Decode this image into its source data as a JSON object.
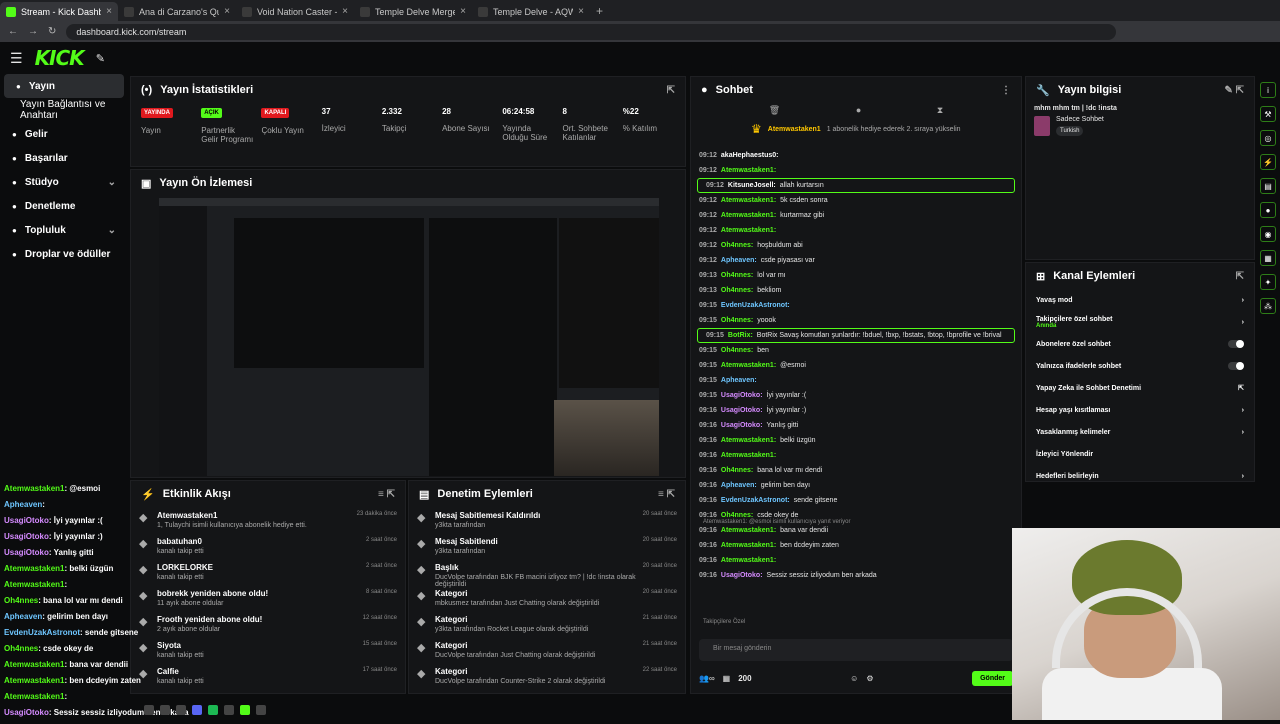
{
  "tabs": [
    {
      "title": "Stream - Kick Dashboard"
    },
    {
      "title": "Ana di Carzano's Quests - AQW"
    },
    {
      "title": "Void Nation Caster - AQW"
    },
    {
      "title": "Temple Delve Merge - AQW"
    },
    {
      "title": "Temple Delve - AQW"
    }
  ],
  "url": "dashboard.kick.com/stream",
  "logo": "KICK",
  "sidebar": [
    {
      "label": "Yayın",
      "icon": "stream-icon",
      "active": true
    },
    {
      "label": "Yayın Bağlantısı ve Anahtarı",
      "sub": true
    },
    {
      "label": "Gelir",
      "icon": "money-icon"
    },
    {
      "label": "Başarılar",
      "icon": "trophy-icon"
    },
    {
      "label": "Stüdyo",
      "icon": "studio-icon",
      "chev": true
    },
    {
      "label": "Denetleme",
      "icon": "hammer-icon"
    },
    {
      "label": "Topluluk",
      "icon": "community-icon",
      "chev": true
    },
    {
      "label": "Droplar ve ödüller",
      "icon": "gift-icon"
    }
  ],
  "stats": {
    "title": "Yayın İstatistikleri",
    "items": [
      {
        "badge": "YAYINDA",
        "label": "Yayın",
        "color": "red"
      },
      {
        "badge": "AÇIK",
        "label": "Partnerlik Gelir Programı",
        "color": "green"
      },
      {
        "badge": "KAPALI",
        "label": "Çoklu Yayın",
        "color": "red"
      },
      {
        "value": "37",
        "label": "İzleyici"
      },
      {
        "value": "2.332",
        "label": "Takipçi"
      },
      {
        "value": "28",
        "label": "Abone Sayısı"
      },
      {
        "value": "06:24:58",
        "label": "Yayında Olduğu Süre"
      },
      {
        "value": "8",
        "label": "Ort. Sohbete Katılanlar"
      },
      {
        "value": "%22",
        "label": "% Katılım"
      }
    ]
  },
  "preview": {
    "title": "Yayın Ön İzlemesi"
  },
  "activity": {
    "title": "Etkinlik Akışı",
    "items": [
      {
        "name": "Atemwastaken1",
        "desc": "1, Tulaychi isimli kullanıcıya abonelik hediye etti.",
        "time": "23 dakika önce"
      },
      {
        "name": "babatuhan0",
        "desc": "kanalı takip etti",
        "time": "2 saat önce"
      },
      {
        "name": "LORKELORKE",
        "desc": "kanalı takip etti",
        "time": "2 saat önce"
      },
      {
        "name": "bobrekk yeniden abone oldu!",
        "desc": "11 ayık abone oldular",
        "time": "8 saat önce"
      },
      {
        "name": "Frooth yeniden abone oldu!",
        "desc": "2 ayık abone oldular",
        "time": "12 saat önce"
      },
      {
        "name": "Siyota",
        "desc": "kanalı takip etti",
        "time": "15 saat önce"
      },
      {
        "name": "Calfie",
        "desc": "kanalı takip etti",
        "time": "17 saat önce"
      }
    ]
  },
  "moderation": {
    "title": "Denetim Eylemleri",
    "items": [
      {
        "name": "Mesaj Sabitlemesi Kaldırıldı",
        "desc": "y3kta tarafından",
        "time": "20 saat önce"
      },
      {
        "name": "Mesaj Sabitlendi",
        "desc": "y3kta tarafından",
        "time": "20 saat önce"
      },
      {
        "name": "Başlık",
        "desc": "DucVolpe tarafından BJK FB macini izliyoz tm? | !dc !insta olarak değiştirildi",
        "time": "20 saat önce"
      },
      {
        "name": "Kategori",
        "desc": "mbkusmez tarafından Just Chatting olarak değiştirildi",
        "time": "20 saat önce"
      },
      {
        "name": "Kategori",
        "desc": "y3kta tarafından Rocket League olarak değiştirildi",
        "time": "21 saat önce"
      },
      {
        "name": "Kategori",
        "desc": "DucVolpe tarafından Just Chatting olarak değiştirildi",
        "time": "21 saat önce"
      },
      {
        "name": "Kategori",
        "desc": "DucVolpe tarafından Counter-Strike 2 olarak değiştirildi",
        "time": "22 saat önce"
      }
    ]
  },
  "chat": {
    "title": "Sohbet",
    "pinned_user": "Atemwastaken1",
    "pinned_text": "1 abonelik hediye ederek 2. sıraya yükselin",
    "messages": [
      {
        "t": "09:12",
        "u": "akaHephaestus0:",
        "m": "",
        "c": "#fff"
      },
      {
        "t": "09:12",
        "u": "Atemwastaken1:",
        "m": "",
        "c": "#53fc18"
      },
      {
        "t": "09:12",
        "u": "KitsuneJosell:",
        "m": "allah kurtarsın",
        "c": "#fff",
        "hl": true
      },
      {
        "t": "09:12",
        "u": "Atemwastaken1:",
        "m": "5k csden sonra",
        "c": "#53fc18"
      },
      {
        "t": "09:12",
        "u": "Atemwastaken1:",
        "m": "kurtarmaz gibi",
        "c": "#53fc18"
      },
      {
        "t": "09:12",
        "u": "Atemwastaken1:",
        "m": "",
        "c": "#53fc18"
      },
      {
        "t": "09:12",
        "u": "Oh4nnes:",
        "m": "hoşbuldum abi",
        "c": "#53fc18"
      },
      {
        "t": "09:12",
        "u": "Apheaven:",
        "m": "csde piyasası var",
        "c": "#6ec6ff"
      },
      {
        "t": "09:13",
        "u": "Oh4nnes:",
        "m": "lol var mı",
        "c": "#53fc18"
      },
      {
        "t": "09:13",
        "u": "Oh4nnes:",
        "m": "bekliom",
        "c": "#53fc18"
      },
      {
        "t": "09:15",
        "u": "EvdenUzakAstronot:",
        "m": "",
        "c": "#6ec6ff"
      },
      {
        "t": "09:15",
        "u": "Oh4nnes:",
        "m": "yoook",
        "c": "#53fc18"
      },
      {
        "t": "09:15",
        "u": "BotRix:",
        "m": "BotRix Savaş komutları şunlardır: !bduel, !bxp, !bstats, !btop, !bprofile ve !brival",
        "c": "#53fc18",
        "hl": true
      },
      {
        "t": "09:15",
        "u": "Oh4nnes:",
        "m": "ben",
        "c": "#53fc18"
      },
      {
        "t": "09:15",
        "u": "Atemwastaken1:",
        "m": "@esmoi",
        "c": "#53fc18"
      },
      {
        "t": "09:15",
        "u": "Apheaven:",
        "m": "",
        "c": "#6ec6ff"
      },
      {
        "t": "09:15",
        "u": "UsagiOtoko:",
        "m": "İyi yayınlar :(",
        "c": "#d58bff"
      },
      {
        "t": "09:16",
        "u": "UsagiOtoko:",
        "m": "İyi yayınlar :)",
        "c": "#d58bff"
      },
      {
        "t": "09:16",
        "u": "UsagiOtoko:",
        "m": "Yanlış gitti",
        "c": "#d58bff"
      },
      {
        "t": "09:16",
        "u": "Atemwastaken1:",
        "m": "belki üzgün",
        "c": "#53fc18"
      },
      {
        "t": "09:16",
        "u": "Atemwastaken1:",
        "m": "",
        "c": "#53fc18"
      },
      {
        "t": "09:16",
        "u": "Oh4nnes:",
        "m": "bana lol var mı dendi",
        "c": "#53fc18"
      },
      {
        "t": "09:16",
        "u": "Apheaven:",
        "m": "gelirim ben dayı",
        "c": "#6ec6ff"
      },
      {
        "t": "09:16",
        "u": "EvdenUzakAstronot:",
        "m": "sende gitsene",
        "c": "#6ec6ff"
      },
      {
        "t": "09:16",
        "u": "Oh4nnes:",
        "m": "csde okey de",
        "c": "#53fc18"
      },
      {
        "t": "09:16",
        "u": "Atemwastaken1:",
        "m": "bana var dendii",
        "c": "#53fc18"
      },
      {
        "t": "09:16",
        "u": "Atemwastaken1:",
        "m": "ben dcdeyim zaten",
        "c": "#53fc18"
      },
      {
        "t": "09:16",
        "u": "Atemwastaken1:",
        "m": "",
        "c": "#53fc18"
      },
      {
        "t": "09:16",
        "u": "UsagiOtoko:",
        "m": "Sessiz sessiz izliyodum ben arkada",
        "c": "#d58bff"
      }
    ],
    "reply_note": "Atemwastaken1: @esmoi isimli kullanıcıya yanıt veriyor",
    "followers_label": "Takipçilere Özel",
    "placeholder": "Bir mesaj gönderin",
    "count": "200",
    "send": "Gönder"
  },
  "info": {
    "title": "Yayın bilgisi",
    "stream_title": "mhm mhm tm | !dc !insta",
    "category": "Sadece Sohbet",
    "tag": "Turkish"
  },
  "actions": {
    "title": "Kanal Eylemleri",
    "items": [
      {
        "label": "Yavaş mod",
        "type": "chev"
      },
      {
        "label": "Takipçilere özel sohbet",
        "sub": "Anında",
        "type": "chev"
      },
      {
        "label": "Abonelere özel sohbet",
        "type": "toggle"
      },
      {
        "label": "Yalnızca ifadelerle sohbet",
        "type": "toggle"
      },
      {
        "label": "Yapay Zeka ile Sohbet Denetimi",
        "type": "ext"
      },
      {
        "label": "Hesap yaşı kısıtlaması",
        "type": "chev"
      },
      {
        "label": "Yasaklanmış kelimeler",
        "type": "chev"
      },
      {
        "label": "İzleyici Yönlendir",
        "type": "none"
      },
      {
        "label": "Hedefleri belirleyin",
        "type": "chev"
      }
    ]
  },
  "overlay": [
    {
      "u": "Atemwastaken1",
      "m": ": @esmoi",
      "c": "#53fc18"
    },
    {
      "u": "Apheaven",
      "m": ":",
      "c": "#6ec6ff"
    },
    {
      "u": "UsagiOtoko",
      "m": ": İyi yayınlar :(",
      "c": "#d58bff"
    },
    {
      "u": "UsagiOtoko",
      "m": ": İyi yayınlar :)",
      "c": "#d58bff"
    },
    {
      "u": "UsagiOtoko",
      "m": ": Yanlış gitti",
      "c": "#d58bff"
    },
    {
      "u": "Atemwastaken1",
      "m": ": belki üzgün",
      "c": "#53fc18"
    },
    {
      "u": "Atemwastaken1",
      "m": ":",
      "c": "#53fc18"
    },
    {
      "u": "Oh4nnes",
      "m": ": bana lol var mı dendi",
      "c": "#53fc18"
    },
    {
      "u": "Apheaven",
      "m": ": gelirim ben dayı",
      "c": "#6ec6ff"
    },
    {
      "u": "EvdenUzakAstronot",
      "m": ": sende gitsene",
      "c": "#6ec6ff"
    },
    {
      "u": "Oh4nnes",
      "m": ": csde okey de",
      "c": "#53fc18"
    },
    {
      "u": "Atemwastaken1",
      "m": ": bana var dendii",
      "c": "#53fc18"
    },
    {
      "u": "Atemwastaken1",
      "m": ": ben dcdeyim zaten",
      "c": "#53fc18"
    },
    {
      "u": "Atemwastaken1",
      "m": ":",
      "c": "#53fc18"
    },
    {
      "u": "UsagiOtoko",
      "m": ": Sessiz sessiz izliyodum ben arkada",
      "c": "#d58bff"
    }
  ]
}
